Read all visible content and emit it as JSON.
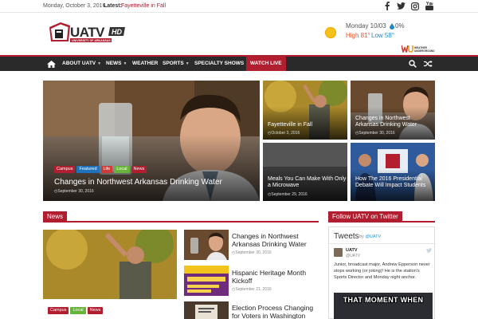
{
  "topbar": {
    "date": "Monday, October 3, 2016",
    "latest_label": "Latest:",
    "latest_link": "Fayetteville in Fall",
    "social": [
      "facebook-icon",
      "twitter-icon",
      "instagram-icon",
      "youtube-icon"
    ]
  },
  "logo": {
    "main": "UATV",
    "sub": "UNIVERSITY OF ARKANSAS",
    "badge": "HD"
  },
  "weather": {
    "date": "Monday 10/03",
    "precip": "0%",
    "high": "High 81°",
    "low": "Low 58°",
    "provider": "WEATHER UNDERGROUND",
    "icon": "sun-icon",
    "high_color": "#e0542a",
    "low_color": "#1e88c9"
  },
  "nav": {
    "items": [
      {
        "label": "ABOUT UATV",
        "caret": true
      },
      {
        "label": "NEWS",
        "caret": true
      },
      {
        "label": "WEATHER",
        "caret": false
      },
      {
        "label": "SPORTS",
        "caret": true
      },
      {
        "label": "SPECIALTY SHOWS",
        "caret": true
      },
      {
        "label": "WATCH LIVE",
        "caret": false
      }
    ]
  },
  "featured": {
    "main": {
      "title": "Changes in Northwest Arkansas Drinking Water",
      "date": "September 30, 2016",
      "tags": [
        "Campus",
        "Featured",
        "Life",
        "Local",
        "News"
      ]
    },
    "tiles": [
      {
        "title": "Fayetteville in Fall",
        "date": "October 3, 2016"
      },
      {
        "title": "Changes in Northwest Arkansas Drinking Water",
        "date": "September 30, 2016"
      },
      {
        "title": "Meals You Can Make With Only a Microwave",
        "date": "September 29, 2016"
      },
      {
        "title": "How The 2016 Presidential Debate Will Impact Students",
        "date": "September 28, 2016"
      }
    ]
  },
  "news": {
    "heading": "News",
    "lead_tags": [
      "Campus",
      "Local",
      "News"
    ],
    "items": [
      {
        "title": "Changes in Northwest Arkansas Drinking Water",
        "date": "September 30, 2016"
      },
      {
        "title": "Hispanic Heritage Month Kickoff",
        "date": "September 21, 2016"
      },
      {
        "title": "Election Process Changing for Voters in Washington",
        "date": ""
      }
    ]
  },
  "twitter": {
    "heading": "Follow UATV on Twitter",
    "title": "Tweets",
    "by": "by",
    "by_handle": "@UATV",
    "name": "UATV",
    "handle": "@UATV",
    "text": "Junior, broadcast major, Andrew Epperson never stops working (or joking)! He is the station's Sports Director and Monday night anchor.",
    "image_caption": "THAT MOMENT WHEN"
  }
}
